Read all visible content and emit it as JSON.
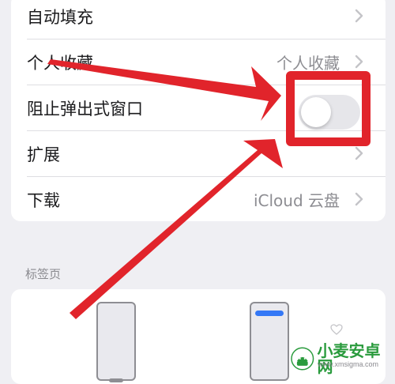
{
  "settings": {
    "rows": [
      {
        "label": "自动填充",
        "value": ""
      },
      {
        "label": "个人收藏",
        "value": "个人收藏"
      },
      {
        "label": "阻止弹出式窗口",
        "value": ""
      },
      {
        "label": "扩展",
        "value": ""
      },
      {
        "label": "下载",
        "value": "iCloud 云盘"
      }
    ],
    "block_popups_enabled": false
  },
  "tabs_section": {
    "title": "标签页"
  },
  "watermark": {
    "brand": "小麦安卓网",
    "site": "www.xmsigma.com"
  },
  "colors": {
    "background": "#efeff3",
    "card": "#ffffff",
    "highlight_red": "#e1242b",
    "secondary_text": "#8d8d92",
    "toggle_off": "#e6e6ea",
    "tab_bar_blue": "#3478f6",
    "watermark_green": "#2a9b3d"
  },
  "icons": [
    "chevron-right-icon",
    "red-arrow-annotation",
    "phone-layout-icon"
  ]
}
